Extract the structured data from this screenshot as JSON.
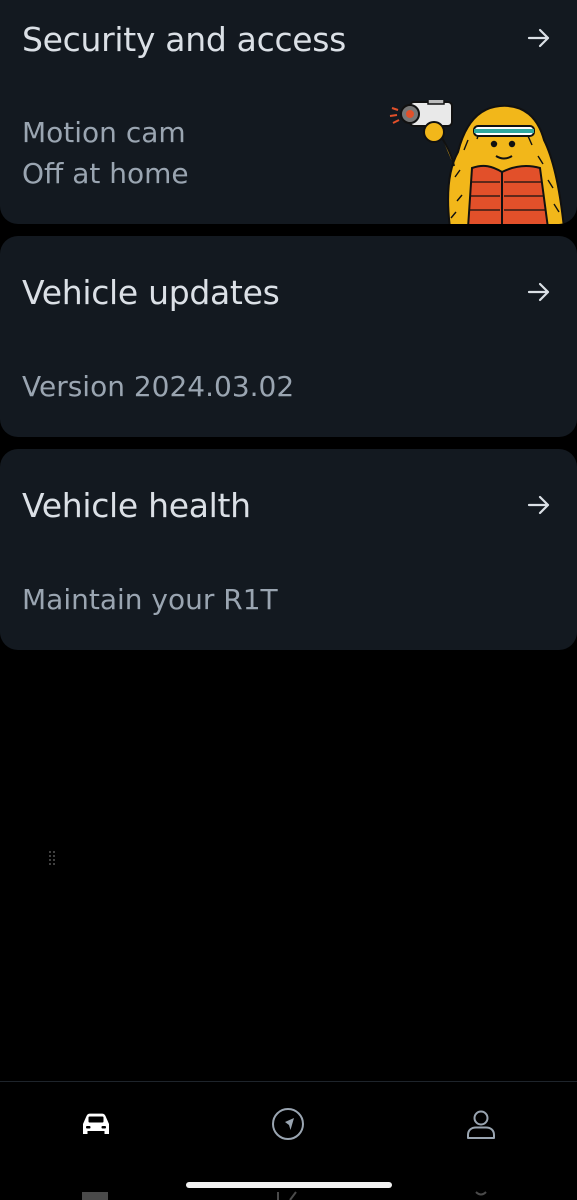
{
  "cards": {
    "security": {
      "title": "Security and access",
      "line1": "Motion cam",
      "line2": "Off at home",
      "illustration": "mascot-with-camcorder-illustration"
    },
    "updates": {
      "title": "Vehicle updates",
      "subtitle": "Version 2024.03.02"
    },
    "health": {
      "title": "Vehicle health",
      "subtitle": "Maintain your R1T"
    }
  },
  "icons": {
    "card_arrow": "arrow-right-icon",
    "tab_vehicle": "vehicle-icon",
    "tab_navigation": "navigation-icon",
    "tab_profile": "profile-icon"
  },
  "colors": {
    "background": "#000000",
    "card": "#131920",
    "title_text": "#dbe0e6",
    "subtitle_text": "#9aa5b1",
    "mascot_fur": "#f2b71a",
    "mascot_vest": "#e2502a",
    "headband": "#2fa8a0"
  }
}
